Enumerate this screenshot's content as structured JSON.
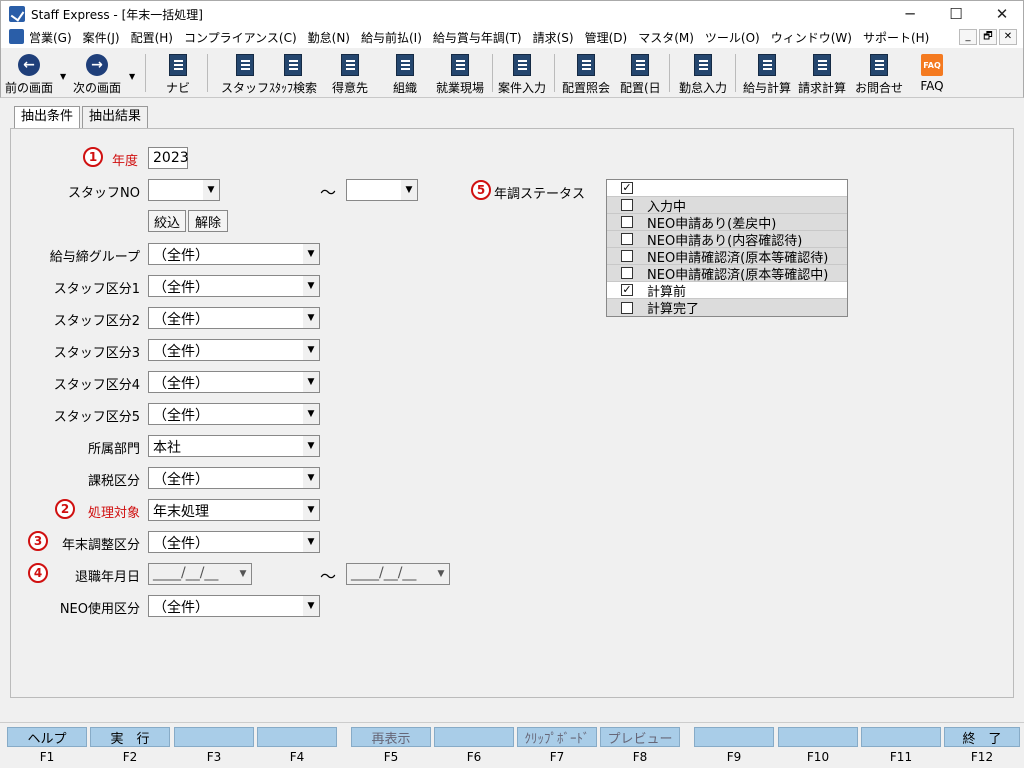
{
  "window": {
    "title": "Staff Express - [年末一括処理]",
    "minimize": "─",
    "maximize": "☐",
    "close": "✕"
  },
  "menu": [
    "営業(G)",
    "案件(J)",
    "配置(H)",
    "コンプライアンス(C)",
    "勤怠(N)",
    "給与前払(I)",
    "給与賞与年調(T)",
    "請求(S)",
    "管理(D)",
    "マスタ(M)",
    "ツール(O)",
    "ウィンドウ(W)",
    "サポート(H)"
  ],
  "mdi": [
    "_",
    "🗗",
    "✕"
  ],
  "toolbar": {
    "prev": "前の画面",
    "prev_glyph": "←",
    "next": "次の画面",
    "next_glyph": "→",
    "navi": "ナビ",
    "staff": "スタッフ",
    "staff_search": "ｽﾀｯﾌ検索",
    "client": "得意先",
    "org": "組織",
    "site": "就業現場",
    "job_input": "案件入力",
    "assign_view": "配置照会",
    "assign_day": "配置(日",
    "attendance": "勤怠入力",
    "payroll": "給与計算",
    "billing": "請求計算",
    "inquiry": "お問合せ",
    "faq": "FAQ",
    "faq_icon": "FAQ"
  },
  "tabs": [
    "抽出条件",
    "抽出結果"
  ],
  "badges": [
    "1",
    "2",
    "3",
    "4",
    "5"
  ],
  "form": {
    "year_label": "年度",
    "year_value": "2023",
    "staff_no_label": "スタッフNO",
    "staff_no_from": "",
    "staff_no_to": "",
    "tilde": "～",
    "filter_button": "絞込",
    "clear_button": "解除",
    "pay_group_label": "給与締グループ",
    "pay_group_value": "（全件）",
    "staff_cat1_label": "スタッフ区分1",
    "staff_cat1_value": "（全件）",
    "staff_cat2_label": "スタッフ区分2",
    "staff_cat2_value": "（全件）",
    "staff_cat3_label": "スタッフ区分3",
    "staff_cat3_value": "（全件）",
    "staff_cat4_label": "スタッフ区分4",
    "staff_cat4_value": "（全件）",
    "staff_cat5_label": "スタッフ区分5",
    "staff_cat5_value": "（全件）",
    "dept_label": "所属部門",
    "dept_value": "本社",
    "tax_label": "課税区分",
    "tax_value": "（全件）",
    "target_label": "処理対象",
    "target_value": "年末処理",
    "adjust_label": "年末調整区分",
    "adjust_value": "（全件）",
    "retire_label": "退職年月日",
    "retire_from": "____/__/__",
    "retire_to": "____/__/__",
    "neo_label": "NEO使用区分",
    "neo_value": "（全件）",
    "status_label": "年調ステータス"
  },
  "status_options": [
    {
      "label": "",
      "checked": true
    },
    {
      "label": "入力中",
      "checked": false
    },
    {
      "label": "NEO申請あり(差戻中)",
      "checked": false
    },
    {
      "label": "NEO申請あり(内容確認待)",
      "checked": false
    },
    {
      "label": "NEO申請確認済(原本等確認待)",
      "checked": false
    },
    {
      "label": "NEO申請確認済(原本等確認中)",
      "checked": false
    },
    {
      "label": "計算前",
      "checked": true
    },
    {
      "label": "計算完了",
      "checked": false
    }
  ],
  "fkeys": [
    {
      "label": "ヘルプ",
      "key": "F1"
    },
    {
      "label": "実　行",
      "key": "F2"
    },
    {
      "label": "",
      "key": "F3"
    },
    {
      "label": "",
      "key": "F4"
    },
    {
      "label": "再表示",
      "key": "F5"
    },
    {
      "label": "",
      "key": "F6"
    },
    {
      "label": "ｸﾘｯﾌﾟﾎﾞｰﾄﾞ",
      "key": "F7"
    },
    {
      "label": "プレビュー",
      "key": "F8"
    },
    {
      "label": "",
      "key": "F9"
    },
    {
      "label": "",
      "key": "F10"
    },
    {
      "label": "",
      "key": "F11"
    },
    {
      "label": "終　了",
      "key": "F12"
    }
  ],
  "colors": {
    "accent_red": "#d01010",
    "fkey_blue": "#a9cde8",
    "toolbar_icon": "#1f3f7a",
    "faq_orange": "#f47a20"
  }
}
